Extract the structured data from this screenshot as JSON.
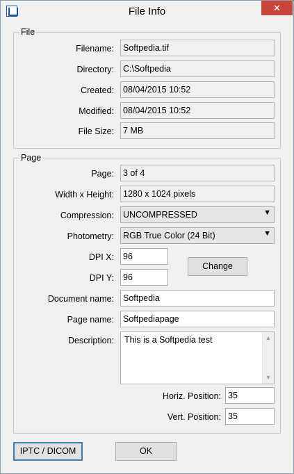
{
  "window": {
    "title": "File Info",
    "close_glyph": "✕",
    "icon": "app-icon"
  },
  "file_group": {
    "legend": "File",
    "filename_label": "Filename:",
    "filename": "Softpedia.tif",
    "directory_label": "Directory:",
    "directory": "C:\\Softpedia",
    "created_label": "Created:",
    "created": "08/04/2015 10:52",
    "modified_label": "Modified:",
    "modified": "08/04/2015 10:52",
    "filesize_label": "File Size:",
    "filesize": "7 MB"
  },
  "page_group": {
    "legend": "Page",
    "page_label": "Page:",
    "page": "3 of 4",
    "wh_label": "Width x Height:",
    "wh": "1280 x 1024 pixels",
    "compression_label": "Compression:",
    "compression": "UNCOMPRESSED",
    "photometry_label": "Photometry:",
    "photometry": "RGB True Color (24 Bit)",
    "dpix_label": "DPI X:",
    "dpix": "96",
    "dpiy_label": "DPI Y:",
    "dpiy": "96",
    "change_button": "Change",
    "docname_label": "Document name:",
    "docname": "Softpedia",
    "pagename_label": "Page name:",
    "pagename": "Softpediapage",
    "description_label": "Description:",
    "description": "This is a Softpedia test",
    "hpos_label": "Horiz. Position:",
    "hpos": "35",
    "vpos_label": "Vert. Position:",
    "vpos": "35"
  },
  "footer": {
    "iptc_button": "IPTC / DICOM",
    "ok_button": "OK"
  },
  "colors": {
    "close": "#c7463b",
    "window_bg": "#f0f0f0",
    "focus": "#3c7fb1"
  }
}
